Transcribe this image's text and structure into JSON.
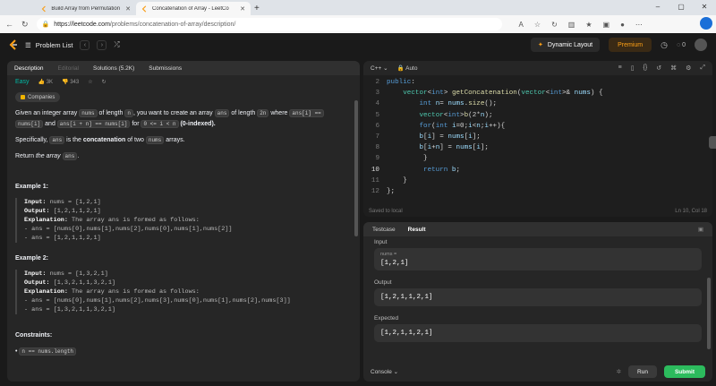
{
  "browser": {
    "tabs": [
      {
        "title": "Build Array from Permutation - L",
        "active": false
      },
      {
        "title": "Concatenation of Array - LeetCo",
        "active": true
      }
    ],
    "url_host": "https://leetcode.com",
    "url_path": "/problems/concatenation-of-array/description/"
  },
  "nav": {
    "problem_list": "Problem List",
    "dynamic_layout": "Dynamic Layout",
    "premium": "Premium",
    "streak": "0"
  },
  "left": {
    "tabs": [
      "Description",
      "Editorial",
      "Solutions (5.2K)",
      "Submissions"
    ],
    "difficulty": "Easy",
    "likes": "3K",
    "dislikes": "343",
    "companies": "Companies",
    "desc": {
      "p1_a": "Given an integer array ",
      "nums": "nums",
      "p1_b": " of length ",
      "n": "n",
      "p1_c": ", you want to create an array ",
      "ans": "ans",
      "p1_d": " of length ",
      "two_n": "2n",
      "p1_e": " where ",
      "c1": "ans[i] ==",
      "c2": "nums[i]",
      "p1_f": " and ",
      "c3": "ans[i + n] == nums[i]",
      "p1_g": " for ",
      "c4": "0 <= i < n",
      "p1_h": " (0-indexed).",
      "p2_a": "Specifically, ",
      "p2_b": " is the ",
      "p2_c": "concatenation",
      "p2_d": " of two ",
      "p2_e": " arrays.",
      "p3_a": "Return ",
      "p3_b": "the array",
      "p3_c": " ans"
    },
    "examples": [
      {
        "title": "Example 1:",
        "input": "nums = [1,2,1]",
        "output": "[1,2,1,1,2,1]",
        "expl": "The array ans is formed as follows:",
        "l1": "- ans = [nums[0],nums[1],nums[2],nums[0],nums[1],nums[2]]",
        "l2": "- ans = [1,2,1,1,2,1]"
      },
      {
        "title": "Example 2:",
        "input": "nums = [1,3,2,1]",
        "output": "[1,3,2,1,1,3,2,1]",
        "expl": "The array ans is formed as follows:",
        "l1": "- ans = [nums[0],nums[1],nums[2],nums[3],nums[0],nums[1],nums[2],nums[3]]",
        "l2": "- ans = [1,3,2,1,1,3,2,1]"
      }
    ],
    "labels": {
      "input": "Input:",
      "output": "Output:",
      "expl": "Explanation:"
    },
    "constraints_title": "Constraints:",
    "constraint1": "n == nums.length"
  },
  "editor": {
    "lang": "C++",
    "mode": "Auto",
    "saved": "Saved to local",
    "cursor": "Ln 10, Col 18"
  },
  "results": {
    "tabs": [
      "Testcase",
      "Result"
    ],
    "input_label": "Input",
    "input_var": "nums =",
    "input_val": "[1,2,1]",
    "output_label": "Output",
    "output_val": "[1,2,1,1,2,1]",
    "expected_label": "Expected",
    "expected_val": "[1,2,1,1,2,1]",
    "console": "Console",
    "run": "Run",
    "submit": "Submit"
  },
  "colors": {
    "accent": "#ffa116",
    "easy": "#00b8a3",
    "submit": "#2cbb5d"
  }
}
